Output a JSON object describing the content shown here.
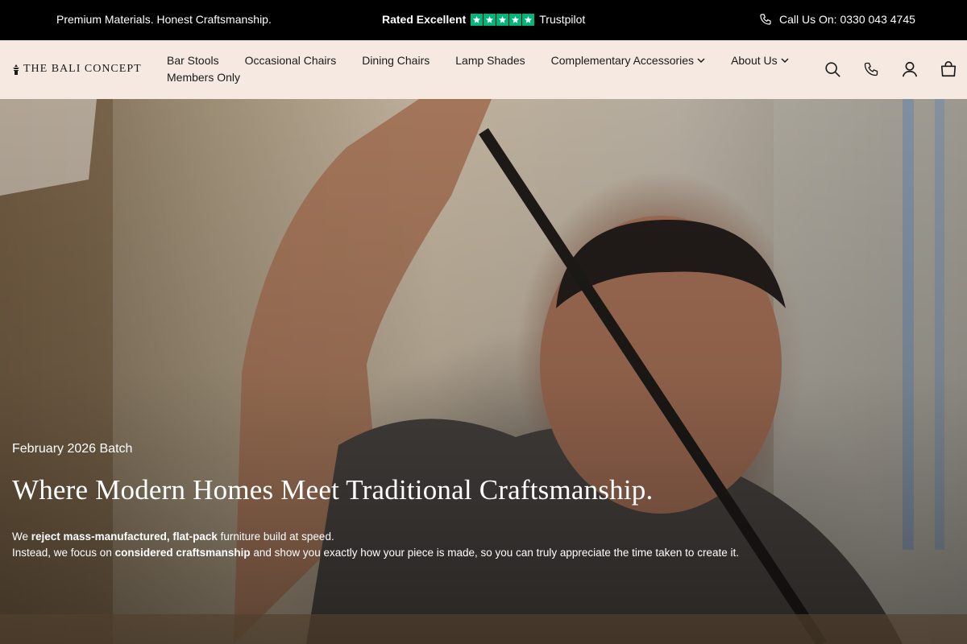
{
  "topbar": {
    "tagline": "Premium Materials. Honest Craftsmanship.",
    "rating_label": "Rated Excellent",
    "rating_stars": 5,
    "rating_source": "Trustpilot",
    "phone_text": "Call Us On: 0330 043 4745"
  },
  "header": {
    "logo_text": "THE BALI CONCEPT",
    "nav": [
      {
        "label": "Bar Stools"
      },
      {
        "label": "Occasional Chairs"
      },
      {
        "label": "Dining Chairs"
      },
      {
        "label": "Lamp Shades"
      },
      {
        "label": "Complementary Accessories",
        "dropdown": true
      },
      {
        "label": "About Us",
        "dropdown": true
      },
      {
        "label": "Members Only"
      }
    ],
    "icons": [
      "search-icon",
      "phone-icon",
      "account-icon",
      "cart-icon"
    ]
  },
  "hero": {
    "kicker": "February 2026 Batch",
    "title": "Where Modern Homes Meet Traditional Craftsmanship.",
    "line1_pre": "We ",
    "line1_bold": "reject mass-manufactured, flat-pack",
    "line1_post": " furniture build at speed.",
    "line2_pre": "Instead, we focus on ",
    "line2_bold": "considered craftsmanship",
    "line2_post": " and show you exactly how your piece is made, so you can truly appreciate the time taken to create it."
  },
  "colors": {
    "topbar_bg": "#000000",
    "header_bg": "#f5e9e1",
    "trustpilot_green": "#00b67a"
  }
}
